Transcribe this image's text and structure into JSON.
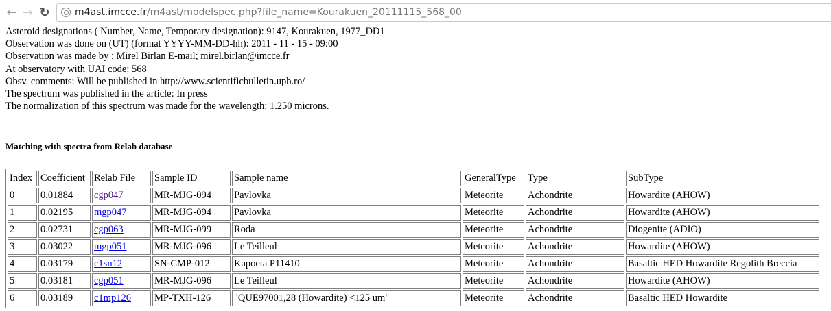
{
  "browser": {
    "url_host": "m4ast.imcce.fr",
    "url_path": "/m4ast/modelspec.php?file_name=Kourakuen_20111115_568_00"
  },
  "info": [
    "Asteroid designations ( Number, Name, Temporary designation): 9147, Kourakuen, 1977_DD1",
    "Observation was done on (UT) (format YYYY-MM-DD-hh): 2011 - 11 - 15 - 09:00",
    "Observation was made by : Mirel Birlan E-mail; mirel.birlan@imcce.fr",
    "At observatory with UAI code: 568",
    "Obsv. comments: Will be published in http://www.scientificbulletin.upb.ro/",
    "The spectrum was published in the article: In press",
    "The normalization of this spectrum was made for the wavelength: 1.250 microns."
  ],
  "section_title": "Matching with spectra from Relab database",
  "table": {
    "headers": [
      "Index",
      "Coefficient",
      "Relab File",
      "Sample ID",
      "Sample name",
      "GeneralType",
      "Type",
      "SubType"
    ],
    "rows": [
      [
        "0",
        "0.01884",
        "cgp047",
        "MR-MJG-094",
        "Pavlovka",
        "Meteorite",
        "Achondrite",
        "Howardite (AHOW)"
      ],
      [
        "1",
        "0.02195",
        "mgp047",
        "MR-MJG-094",
        "Pavlovka",
        "Meteorite",
        "Achondrite",
        "Howardite (AHOW)"
      ],
      [
        "2",
        "0.02731",
        "cgp063",
        "MR-MJG-099",
        "Roda",
        "Meteorite",
        "Achondrite",
        "Diogenite (ADIO)"
      ],
      [
        "3",
        "0.03022",
        "mgp051",
        "MR-MJG-096",
        "Le Teilleul",
        "Meteorite",
        "Achondrite",
        "Howardite (AHOW)"
      ],
      [
        "4",
        "0.03179",
        "c1sn12",
        "SN-CMP-012",
        "Kapoeta P11410",
        "Meteorite",
        "Achondrite",
        "Basaltic HED Howardite Regolith Breccia"
      ],
      [
        "5",
        "0.03181",
        "cgp051",
        "MR-MJG-096",
        "Le Teilleul",
        "Meteorite",
        "Achondrite",
        "Howardite (AHOW)"
      ],
      [
        "6",
        "0.03189",
        "c1mp126",
        "MP-TXH-126",
        "\"QUE97001,28 (Howardite) <125 um\"",
        "Meteorite",
        "Achondrite",
        "Basaltic HED Howardite"
      ]
    ]
  },
  "colors": {
    "link": "#0000ee",
    "link_visited": "#551a8b",
    "table_border": "#808080"
  },
  "icons": {
    "back": "arrow-left",
    "forward": "arrow-right",
    "reload": "reload",
    "site_info": "globe"
  }
}
